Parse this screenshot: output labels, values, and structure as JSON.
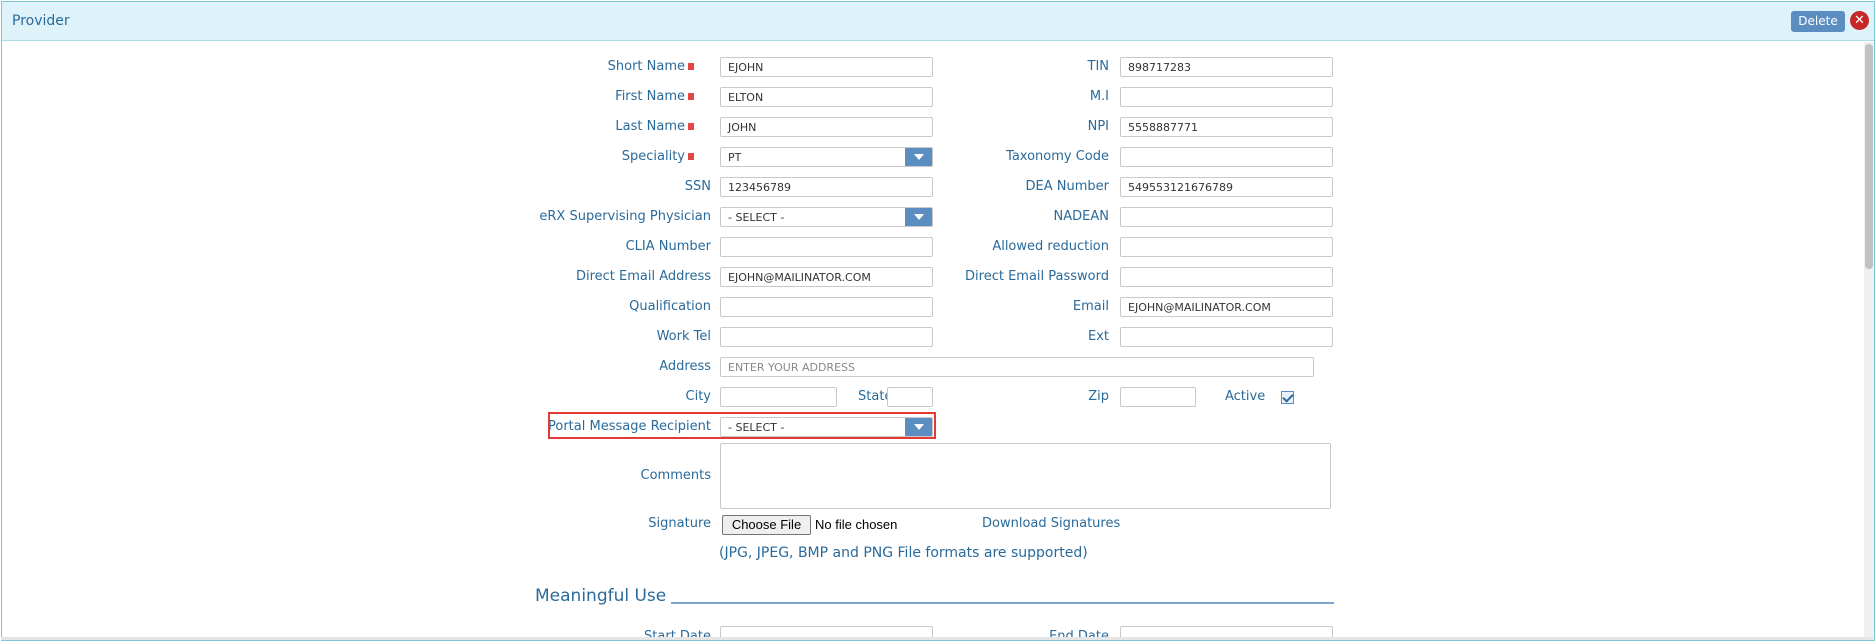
{
  "window": {
    "title": "Provider",
    "delete_label": "Delete",
    "close_symbol": "✕"
  },
  "form": {
    "short_name": {
      "label": "Short Name",
      "value": "EJOHN"
    },
    "first_name": {
      "label": "First Name",
      "value": "ELTON"
    },
    "last_name": {
      "label": "Last Name",
      "value": "JOHN"
    },
    "speciality": {
      "label": "Speciality",
      "value": "PT"
    },
    "ssn": {
      "label": "SSN",
      "value": "123456789"
    },
    "erx_supervising_physician": {
      "label": "eRX Supervising Physician",
      "value": "- SELECT -"
    },
    "clia_number": {
      "label": "CLIA Number",
      "value": ""
    },
    "direct_email_address": {
      "label": "Direct Email Address",
      "value": "EJOHN@MAILINATOR.COM"
    },
    "qualification": {
      "label": "Qualification",
      "value": ""
    },
    "work_tel": {
      "label": "Work Tel",
      "value": ""
    },
    "tin": {
      "label": "TIN",
      "value": "898717283"
    },
    "mi": {
      "label": "M.I",
      "value": ""
    },
    "npi": {
      "label": "NPI",
      "value": "5558887771"
    },
    "taxonomy_code": {
      "label": "Taxonomy Code",
      "value": ""
    },
    "dea_number": {
      "label": "DEA Number",
      "value": "549553121676789"
    },
    "nadean": {
      "label": "NADEAN",
      "value": ""
    },
    "allowed_reduction": {
      "label": "Allowed reduction",
      "value": ""
    },
    "direct_email_password": {
      "label": "Direct Email Password",
      "value": ""
    },
    "email": {
      "label": "Email",
      "value": "EJOHN@MAILINATOR.COM"
    },
    "ext": {
      "label": "Ext",
      "value": ""
    },
    "address": {
      "label": "Address",
      "value": "",
      "placeholder": "ENTER YOUR ADDRESS"
    },
    "city": {
      "label": "City",
      "value": ""
    },
    "state": {
      "label": "State",
      "value": ""
    },
    "zip": {
      "label": "Zip",
      "value": ""
    },
    "active": {
      "label": "Active",
      "checked": true
    },
    "portal_message_recipient": {
      "label": "Portal Message Recipient",
      "value": "- SELECT -"
    },
    "comments": {
      "label": "Comments",
      "value": ""
    },
    "signature": {
      "label": "Signature",
      "choose_file_label": "Choose File",
      "no_file_text": "No file chosen",
      "download_link": "Download Signatures",
      "formats_note": "(JPG, JPEG, BMP and PNG File formats are supported)"
    }
  },
  "meaningful_use": {
    "title": "Meaningful Use",
    "start_date_label": "Start Date",
    "end_date_label": "End Date"
  }
}
